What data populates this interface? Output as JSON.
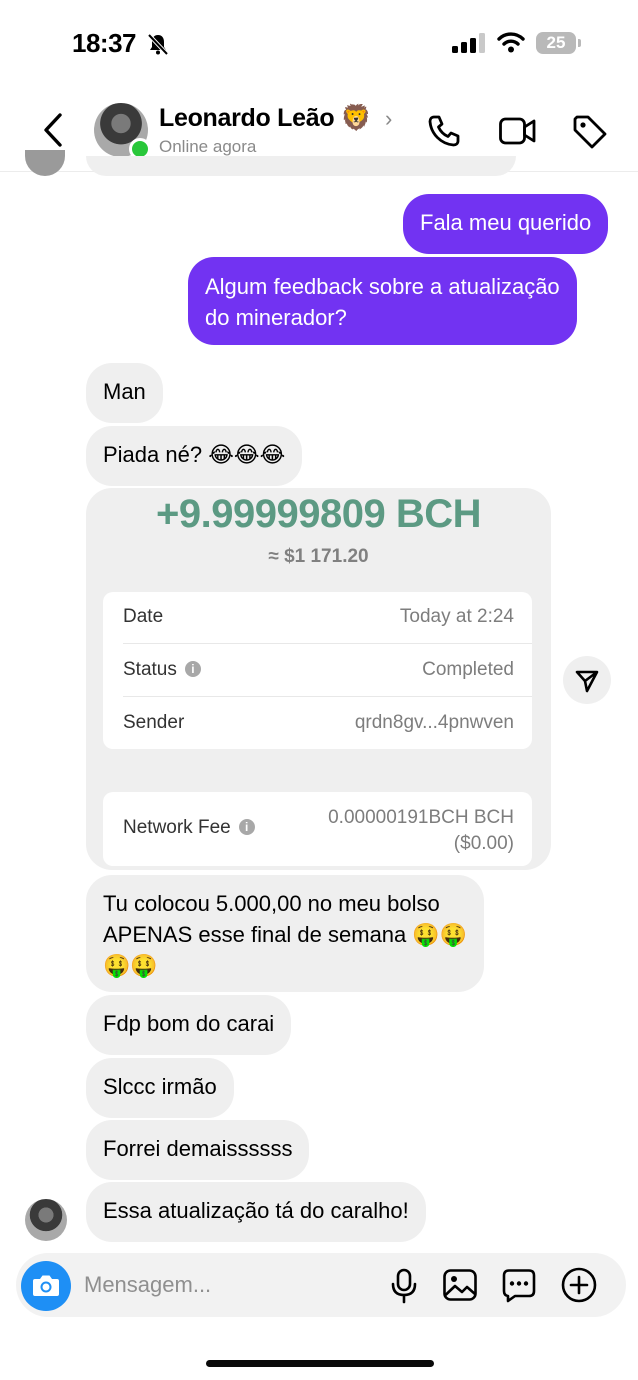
{
  "status_bar": {
    "time": "18:37",
    "battery": "25"
  },
  "header": {
    "contact_name": "Leonardo Leão 🦁",
    "contact_status": "Online agora"
  },
  "messages": {
    "m1": "Fala meu querido",
    "m2_line1": "Algum feedback sobre a atualização",
    "m2_line2": "do minerador?",
    "m3": "Man",
    "m4": "Piada né? 😂😂😂",
    "m6_line1": "Tu colocou 5.000,00 no meu bolso",
    "m6_line2": "APENAS esse final de semana 🤑🤑",
    "m6_line3": "🤑🤑",
    "m7": "Fdp bom do carai",
    "m8": "Slccc irmão",
    "m9": "Forrei demaissssss",
    "m10": "Essa atualização tá do caralho!"
  },
  "transaction": {
    "amount": "+9.99999809 BCH",
    "fiat": "≈ $1 171.20",
    "rows": [
      {
        "label": "Date",
        "value": "Today at 2:24"
      },
      {
        "label": "Status",
        "value": "Completed"
      },
      {
        "label": "Sender",
        "value": "qrdn8gv...4pnwven"
      }
    ],
    "fee_label": "Network Fee",
    "fee_value_line1": "0.00000191BCH BCH",
    "fee_value_line2": "($0.00)"
  },
  "composer": {
    "placeholder": "Mensagem..."
  },
  "colors": {
    "outgoing": "#7233f2",
    "incoming": "#efefef",
    "amount": "#5c9a83",
    "camera": "#1e8ff5"
  },
  "icons": [
    "bell-slash-icon",
    "signal-icon",
    "wifi-icon",
    "battery-icon",
    "back-arrow-icon",
    "chevron-right-icon",
    "phone-icon",
    "video-icon",
    "tag-icon",
    "info-icon",
    "send-icon",
    "camera-icon",
    "microphone-icon",
    "image-icon",
    "sticker-icon",
    "plus-icon"
  ]
}
